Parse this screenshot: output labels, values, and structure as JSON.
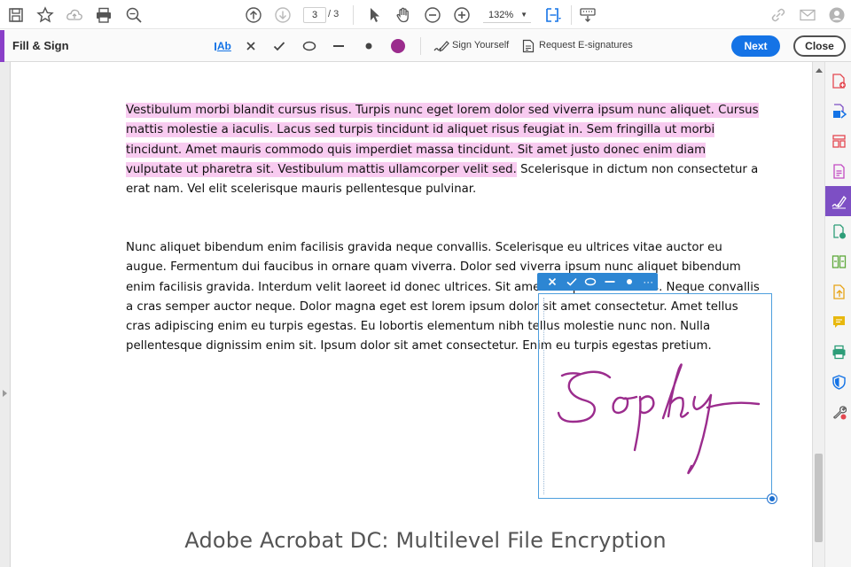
{
  "top_toolbar": {
    "page_current": "3",
    "page_total": "/ 3",
    "zoom": "132%"
  },
  "fill_sign_bar": {
    "title": "Fill & Sign",
    "text_tool": "Ab",
    "sign_yourself": "Sign Yourself",
    "request_esignatures": "Request E-signatures",
    "next_label": "Next",
    "close_label": "Close",
    "color_swatch": "#9b2c8d"
  },
  "document": {
    "paragraph1_highlighted": "Vestibulum morbi blandit cursus risus. Turpis nunc eget lorem dolor sed viverra ipsum nunc aliquet. Cursus mattis molestie a iaculis. Lacus sed turpis tincidunt id aliquet risus feugiat in. Sem fringilla ut morbi tincidunt. Amet mauris commodo quis imperdiet massa tincidunt. Sit amet justo donec enim diam vulputate ut pharetra sit. Vestibulum mattis ullamcorper velit sed.",
    "paragraph1_rest": " Scelerisque in dictum non consectetur a erat nam. Vel elit scelerisque mauris pellentesque pulvinar.",
    "paragraph2": "Nunc aliquet bibendum enim facilisis gravida neque convallis. Scelerisque eu ultrices vitae auctor eu augue. Fermentum dui faucibus in ornare quam viverra. Dolor sed viverra ipsum nunc aliquet bibendum enim facilisis gravida. Interdum velit laoreet id donec ultrices. Sit amet nisl purus in mollis. Neque convallis a cras semper auctor neque. Dolor magna eget est lorem ipsum dolor sit amet consectetur. Amet tellus cras adipiscing enim eu turpis egestas. Eu lobortis elementum nibh tellus molestie nunc non. Nulla pellentesque dignissim enim sit. Ipsum dolor sit amet consectetur. Enim eu turpis egestas pretium.",
    "highlight_color": "#f8cbf0"
  },
  "signature": {
    "text": "Sophy",
    "ink_color": "#9b2c8d",
    "more_label": "···"
  },
  "caption": "Adobe Acrobat DC: Multilevel File Encryption",
  "colors": {
    "accent_blue": "#1473e6",
    "fill_sign_purple": "#7d4fc4"
  }
}
